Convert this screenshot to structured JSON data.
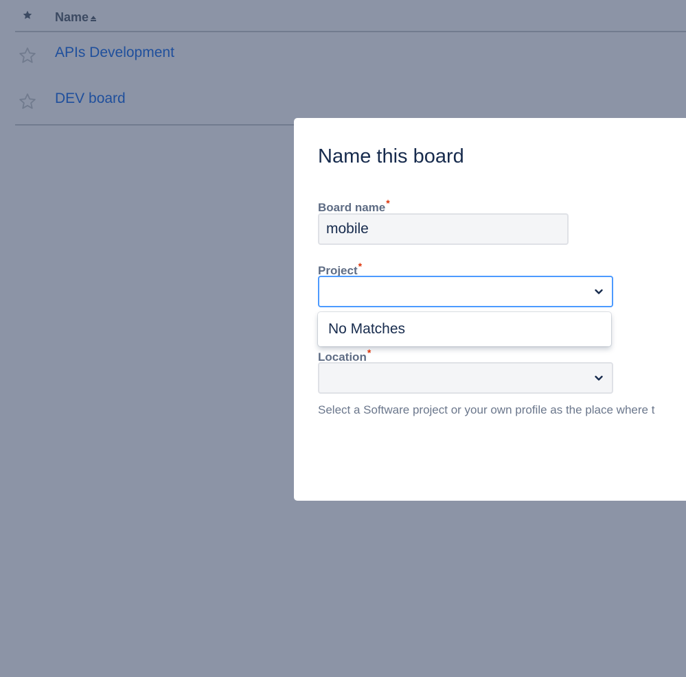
{
  "table": {
    "header": {
      "star_icon": "star-filled-icon",
      "name_label": "Name",
      "sort_icon": "sort-ascending-icon"
    },
    "rows": [
      {
        "name": "APIs Development",
        "star_icon": "star-outline-icon"
      },
      {
        "name": "DEV board",
        "star_icon": "star-outline-icon"
      }
    ]
  },
  "modal": {
    "title": "Name this board",
    "board_name": {
      "label": "Board name",
      "required_mark": "*",
      "value": "mobile"
    },
    "project": {
      "label": "Project",
      "required_mark": "*",
      "value": "",
      "dropdown_message": "No Matches",
      "chevron_icon": "chevron-down-icon"
    },
    "location": {
      "label": "Location",
      "required_mark": "*",
      "value": "",
      "chevron_icon": "chevron-down-icon",
      "helper_text": "Select a Software project or your own profile as the place where t"
    }
  },
  "colors": {
    "overlay_background": "#8c94a6",
    "link": "#1f4f9c",
    "focus_border": "#4c9aff",
    "required": "#de350b"
  }
}
